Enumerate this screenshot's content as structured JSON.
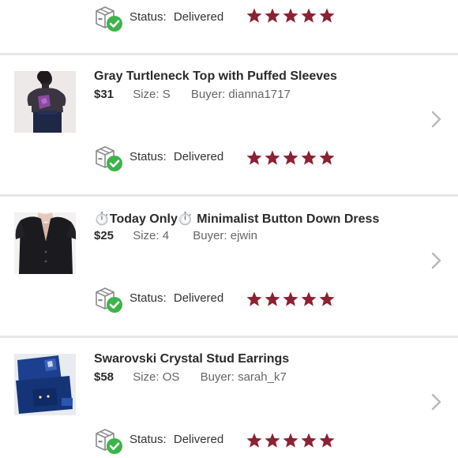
{
  "accent": {
    "star": "#8b2232",
    "check": "#3cb44a",
    "divider": "#e6e6e6"
  },
  "items": [
    {
      "title": "",
      "price": "",
      "size": "",
      "buyer": "",
      "status_label": "Status:",
      "status_value": "Delivered",
      "rating": 5,
      "thumbnail": ""
    },
    {
      "title": "Gray Turtleneck Top with Puffed Sleeves",
      "price": "$31",
      "size": "Size: S",
      "buyer": "Buyer: dianna1717",
      "status_label": "Status:",
      "status_value": "Delivered",
      "rating": 5,
      "thumbnail": "turtleneck-photo"
    },
    {
      "title": "⏱️Today Only⏱️ Minimalist Button Down Dress",
      "price": "$25",
      "size": "Size: 4",
      "buyer": "Buyer: ejwin",
      "status_label": "Status:",
      "status_value": "Delivered",
      "rating": 5,
      "thumbnail": "dress-photo"
    },
    {
      "title": "Swarovski Crystal Stud Earrings",
      "price": "$58",
      "size": "Size: OS",
      "buyer": "Buyer: sarah_k7",
      "status_label": "Status:",
      "status_value": "Delivered",
      "rating": 5,
      "thumbnail": "earrings-photo"
    }
  ]
}
